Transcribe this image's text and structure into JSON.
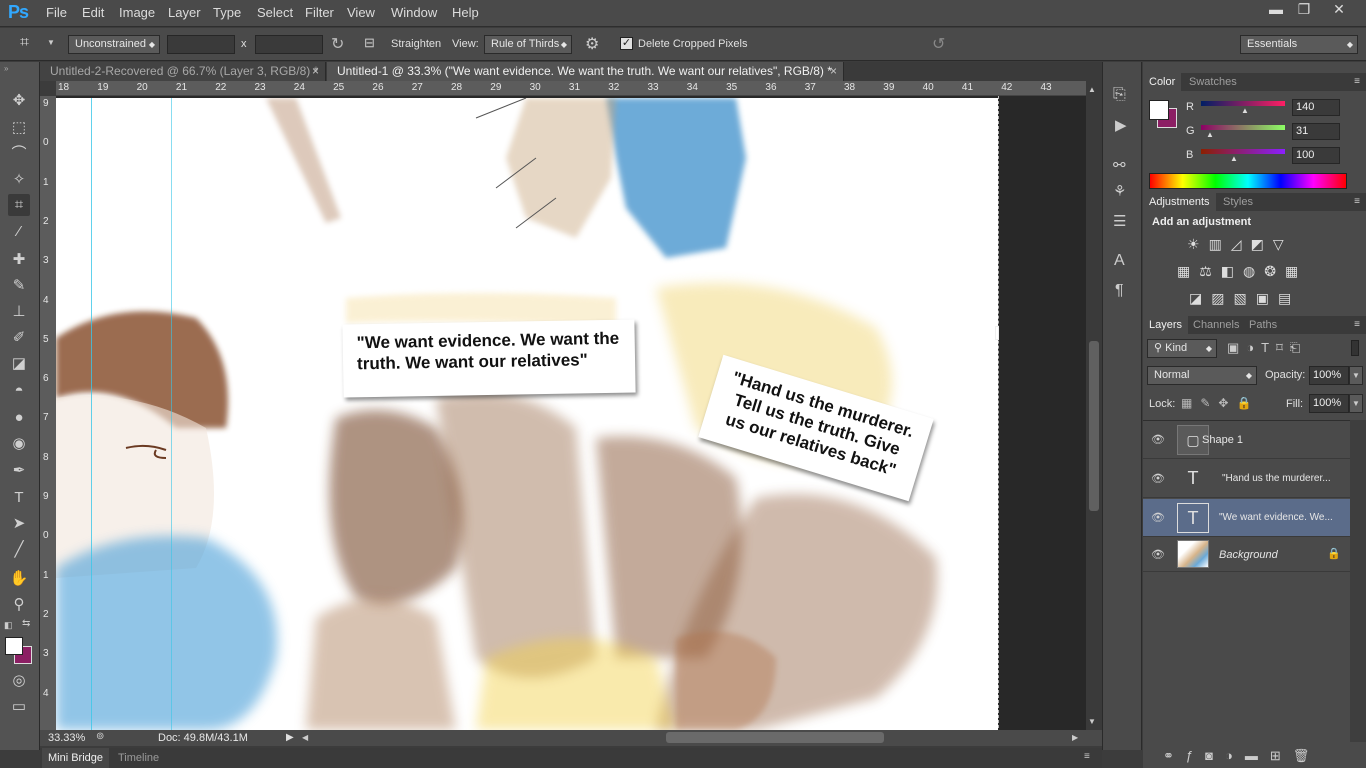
{
  "app": {
    "logo": "Ps"
  },
  "menu": [
    "File",
    "Edit",
    "Image",
    "Layer",
    "Type",
    "Select",
    "Filter",
    "View",
    "Window",
    "Help"
  ],
  "window_controls": {
    "minimize": "▬",
    "restore": "❐",
    "close": "✕"
  },
  "options": {
    "ratio": "Unconstrained",
    "x_sep": "x",
    "straighten": "Straighten",
    "view_label": "View:",
    "overlay": "Rule of Thirds",
    "delete_cropped": "Delete Cropped Pixels",
    "workspace": "Essentials"
  },
  "doc_tabs": [
    {
      "title": "Untitled-2-Recovered @ 66.7% (Layer 3, RGB/8) *",
      "close": "×"
    },
    {
      "title": "Untitled-1 @ 33.3% (\"We want evidence. We want the truth. We want our relatives\", RGB/8) *",
      "close": "×"
    }
  ],
  "ruler_top": [
    "18",
    "19",
    "20",
    "21",
    "22",
    "23",
    "24",
    "25",
    "26",
    "27",
    "28",
    "29",
    "30",
    "31",
    "32",
    "33",
    "34",
    "35",
    "36",
    "37",
    "38",
    "39",
    "40",
    "41",
    "42",
    "43"
  ],
  "ruler_left": [
    "9",
    "0",
    "1",
    "2",
    "3",
    "4",
    "5",
    "6",
    "7",
    "8",
    "9",
    "0",
    "1",
    "2",
    "3",
    "4"
  ],
  "canvas": {
    "bubble1": "\"We want evidence. We want the truth. We want our relatives\"",
    "bubble2": "\"Hand us the murderer. Tell us the truth. Give us our relatives back\""
  },
  "status": {
    "zoom": "33.33%",
    "doc": "Doc: 49.8M/43.1M"
  },
  "bottom_tabs": [
    "Mini Bridge",
    "Timeline"
  ],
  "color_panel": {
    "tabs": [
      "Color",
      "Swatches"
    ],
    "r_label": "R",
    "g_label": "G",
    "b_label": "B",
    "r": "140",
    "g": "31",
    "b": "100",
    "fg": "#ffffff",
    "bg": "#8c1f64"
  },
  "adjustments": {
    "tabs": [
      "Adjustments",
      "Styles"
    ],
    "heading": "Add an adjustment"
  },
  "layers_panel": {
    "tabs": [
      "Layers",
      "Channels",
      "Paths"
    ],
    "filter": "Kind",
    "blend": "Normal",
    "opacity_label": "Opacity:",
    "opacity": "100%",
    "lock_label": "Lock:",
    "fill_label": "Fill:",
    "fill": "100%",
    "layers": [
      {
        "name": "Shape 1",
        "thumb": "▢"
      },
      {
        "name": "\"Hand us the murderer...",
        "thumb": "T"
      },
      {
        "name": "\"We want evidence. We...",
        "thumb": "T"
      },
      {
        "name": "Background",
        "thumb": ""
      }
    ]
  }
}
